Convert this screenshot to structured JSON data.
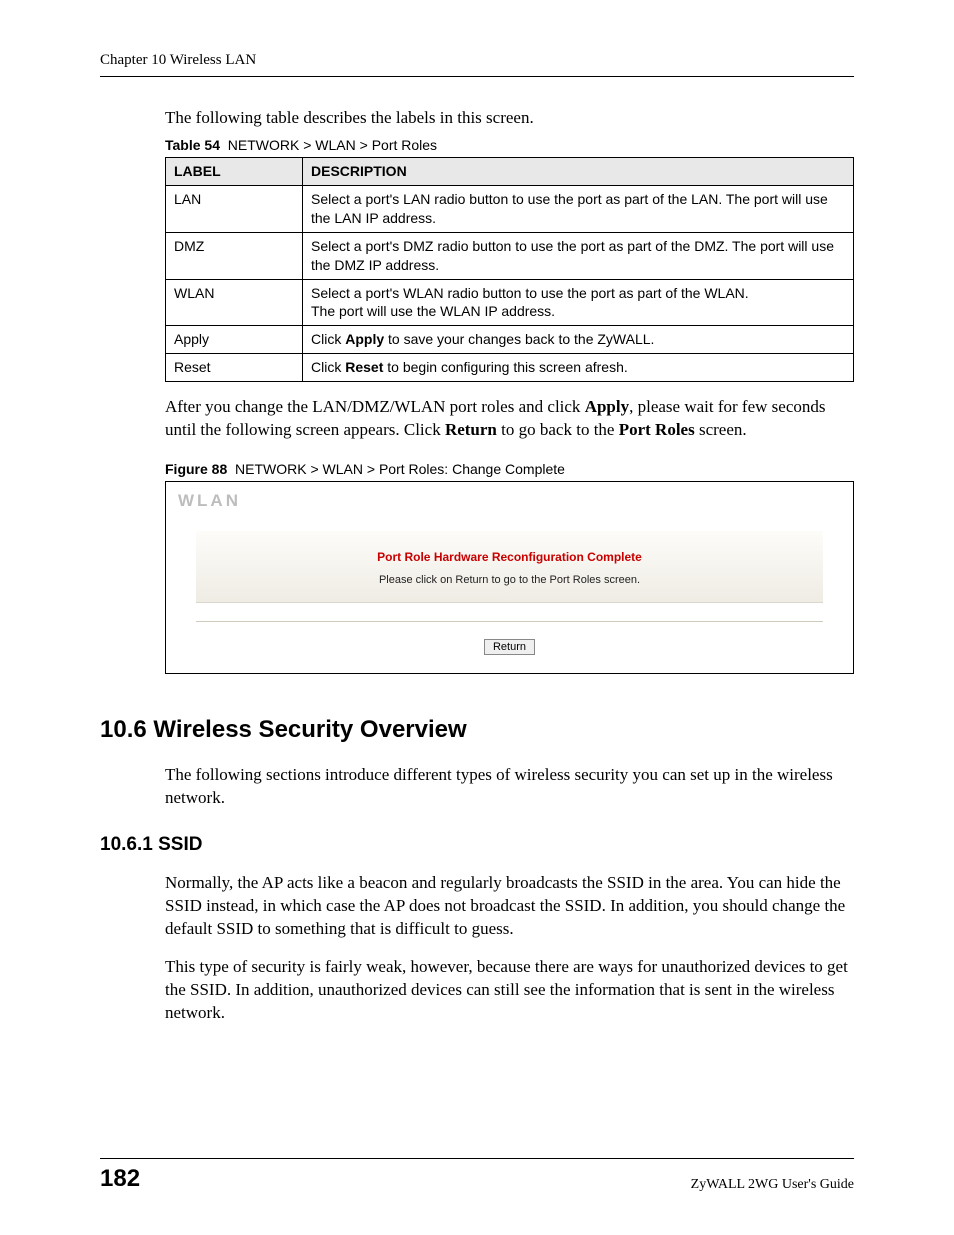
{
  "header": {
    "chapter": "Chapter 10 Wireless LAN"
  },
  "intro": "The following table describes the labels in this screen.",
  "table": {
    "caption_label": "Table 54",
    "caption_text": "NETWORK > WLAN > Port Roles",
    "headers": {
      "c1": "LABEL",
      "c2": "DESCRIPTION"
    },
    "rows": [
      {
        "label": "LAN",
        "desc_pre": "Select a port's LAN radio button to use the port as part of the LAN. The port will use the LAN IP address."
      },
      {
        "label": "DMZ",
        "desc_pre": "Select a port's DMZ radio button to use the port as part of the DMZ. The port will use the DMZ IP address."
      },
      {
        "label": "WLAN",
        "desc_line1": "Select a port's WLAN radio button to use the port as part of the WLAN.",
        "desc_line2": "The port will use the WLAN IP address."
      },
      {
        "label": "Apply",
        "desc_pre": "Click ",
        "bold": "Apply",
        "desc_post": " to save your changes back to the ZyWALL."
      },
      {
        "label": "Reset",
        "desc_pre": "Click ",
        "bold": "Reset",
        "desc_post": " to begin configuring this screen afresh."
      }
    ]
  },
  "after_table": {
    "t1": "After you change the LAN/DMZ/WLAN port roles and click ",
    "b1": "Apply",
    "t2": ", please wait for few seconds until the following screen appears. Click ",
    "b2": "Return",
    "t3": " to go back to the ",
    "b3": "Port Roles",
    "t4": " screen."
  },
  "figure": {
    "caption_label": "Figure 88",
    "caption_text": "NETWORK > WLAN > Port Roles: Change Complete",
    "panel_label": "WLAN",
    "red_title": "Port Role Hardware Reconfiguration Complete",
    "note": "Please click on Return to go to the Port Roles screen.",
    "button": "Return"
  },
  "section_10_6": {
    "heading": "10.6  Wireless Security Overview",
    "para": "The following sections introduce different types of wireless security you can set up in the wireless network."
  },
  "section_10_6_1": {
    "heading": "10.6.1  SSID",
    "para1": "Normally, the AP acts like a beacon and regularly broadcasts the SSID in the area. You can hide the SSID instead, in which case the AP does not broadcast the SSID. In addition, you should change the default SSID to something that is difficult to guess.",
    "para2": "This type of security is fairly weak, however, because there are ways for unauthorized devices to get the SSID. In addition, unauthorized devices can still see the information that is sent in the wireless network."
  },
  "footer": {
    "page": "182",
    "guide": "ZyWALL 2WG User's Guide"
  }
}
